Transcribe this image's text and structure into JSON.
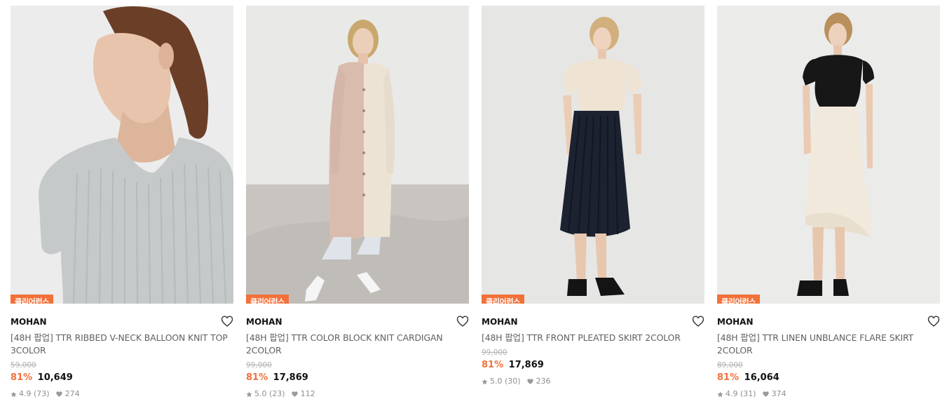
{
  "products": [
    {
      "badge": "클리어런스",
      "brand": "MOHAN",
      "name": "[48H 팝업] TTR RIBBED V-NECK BALLOON KNIT TOP 3COLOR",
      "original_price": "59,000",
      "discount": "81%",
      "price": "10,649",
      "rating": "4.9 (73)",
      "likes": "274",
      "image_icon": "product-photo-knit-top"
    },
    {
      "badge": "클리어런스",
      "brand": "MOHAN",
      "name": "[48H 팝업] TTR COLOR BLOCK KNIT CARDIGAN 2COLOR",
      "original_price": "99,000",
      "discount": "81%",
      "price": "17,869",
      "rating": "5.0 (23)",
      "likes": "112",
      "image_icon": "product-photo-cardigan"
    },
    {
      "badge": "클리어런스",
      "brand": "MOHAN",
      "name": "[48H 팝업] TTR FRONT PLEATED SKIRT 2COLOR",
      "original_price": "99,000",
      "discount": "81%",
      "price": "17,869",
      "rating": "5.0 (30)",
      "likes": "236",
      "image_icon": "product-photo-pleated-skirt"
    },
    {
      "badge": "클리어런스",
      "brand": "MOHAN",
      "name": "[48H 팝업] TTR LINEN UNBLANCE FLARE SKIRT 2COLOR",
      "original_price": "89,000",
      "discount": "81%",
      "price": "16,064",
      "rating": "4.9 (31)",
      "likes": "374",
      "image_icon": "product-photo-flare-skirt"
    }
  ],
  "colors": {
    "badge": "#f2713a",
    "discount": "#f2713a",
    "text_primary": "#111111",
    "text_secondary": "#5f5f5f",
    "text_muted": "#8f8f8f"
  }
}
